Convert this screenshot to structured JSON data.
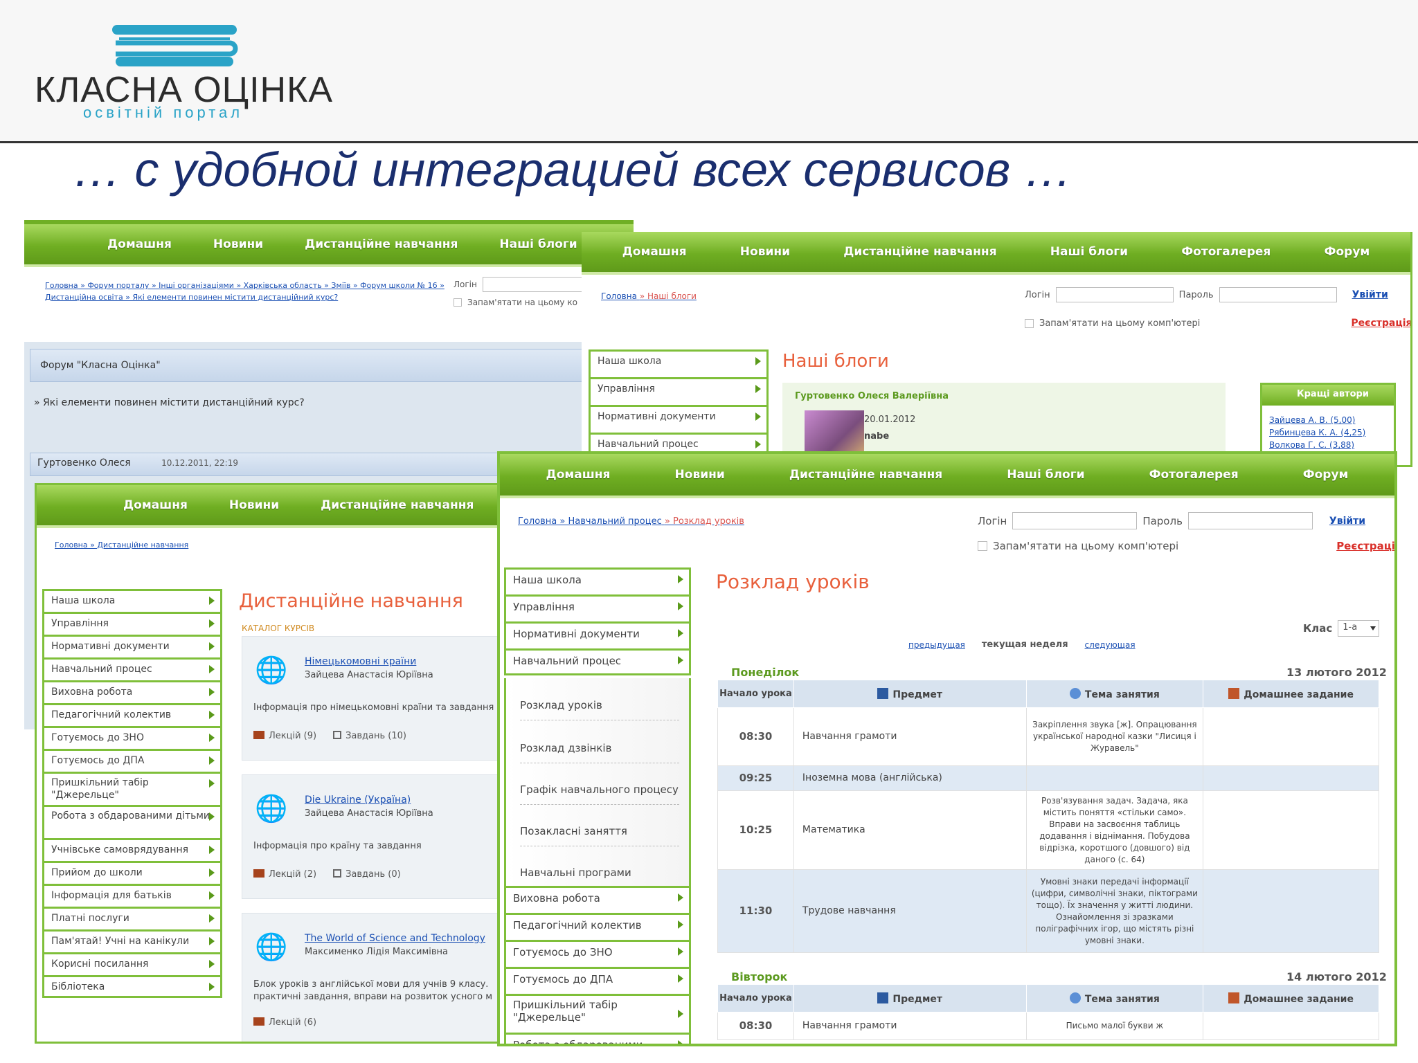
{
  "slide": {
    "logo_title": "КЛАСНА ОЦІНКА",
    "logo_subtitle": "освітній портал",
    "title": "… с удобной интеграцией всех сервисов …"
  },
  "forum": {
    "nav": [
      "Домашня",
      "Новини",
      "Дистанційне навчання",
      "Наші блоги"
    ],
    "breadcrumb": "Головна » Форум порталу » Інші організаціями » Харківська область » Зміїв » Форум школи № 16 » Дистанційна освіта » Які елементи повинен містити дистанційний курс?",
    "login_label": "Логін",
    "remember": "Запам'ятати на цьому ко",
    "forum_name": "Форум \"Класна Оцінка\"",
    "topic": "» Які елементи повинен містити дистанційний курс?",
    "author": "Гуртовенко Олеся",
    "post_date": "10.12.2011, 22:19"
  },
  "blogs": {
    "nav": [
      "Домашня",
      "Новини",
      "Дистанційне навчання",
      "Наші блоги",
      "Фотогалерея",
      "Форум"
    ],
    "breadcrumb_home": "Головна",
    "breadcrumb_current": "» Наші блоги",
    "login_label": "Логін",
    "password_label": "Пароль",
    "login_btn": "Увійти",
    "remember": "Запам'ятати на цьому комп'ютері",
    "register": "Реєстрація",
    "menu": [
      "Наша школа",
      "Управління",
      "Нормативні документи",
      "Навчальний процес"
    ],
    "heading": "Наші блоги",
    "blog_author": "Гуртовенко Олеся Валеріївна",
    "blog_date": "20.01.2012",
    "blog_text": "nabe",
    "best_title": "Кращі автори",
    "best_authors": [
      "Зайцева А. В. (5,00)",
      "Рябинцева К. А. (4,25)",
      "Волкова Г. С. (3,88)"
    ]
  },
  "distance": {
    "nav": [
      "Домашня",
      "Новини",
      "Дистанційне навчання"
    ],
    "breadcrumb": "Головна » Дистанційне навчання",
    "menu": [
      "Наша школа",
      "Управління",
      "Нормативні документи",
      "Навчальний процес",
      "Виховна робота",
      "Педагогічний колектив",
      "Готуємось до ЗНО",
      "Готуємось до ДПА",
      "Пришкільний табір \"Джерельце\"",
      "Робота з обдарованими дітьми",
      "Учнівське самоврядування",
      "Прийом до школи",
      "Інформація для батьків",
      "Платні послуги",
      "Пам'ятай! Учні на канікули",
      "Корисні посилання",
      "Бібліотека"
    ],
    "heading": "Дистанційне навчання",
    "catalog": "КАТАЛОГ КУРСІВ",
    "courses": [
      {
        "title": "Німецькомовні країни",
        "author": "Зайцева Анастасія Юріївна",
        "desc": "Інформація про німецькомовні країни та завдання",
        "lectures": "Лекцій (9)",
        "tasks": "Завдань (10)"
      },
      {
        "title": "Die Ukraine (Україна)",
        "author": "Зайцева Анастасія Юріївна",
        "desc": "Інформація про країну та завдання",
        "lectures": "Лекцій (2)",
        "tasks": "Завдань (0)"
      },
      {
        "title": "The World of Science and Technology",
        "author": "Максименко Лідія Максимівна",
        "desc": "Блок уроків з англійської мови для учнів 9 класу. практичні завдання, вправи на розвиток усного м",
        "lectures": "Лекцій (6)",
        "tasks": ""
      }
    ]
  },
  "schedule": {
    "nav": [
      "Домашня",
      "Новини",
      "Дистанційне навчання",
      "Наші блоги",
      "Фотогалерея",
      "Форум"
    ],
    "breadcrumb_parts": [
      "Головна",
      "Навчальний процес"
    ],
    "breadcrumb_current": "» Розклад уроків",
    "login_label": "Логін",
    "password_label": "Пароль",
    "login_btn": "Увійти",
    "remember": "Запам'ятати на цьому комп'ютері",
    "register": "Реєстрація",
    "menu_top": [
      "Наша школа",
      "Управління",
      "Нормативні документи",
      "Навчальний процес"
    ],
    "submenu": [
      "Розклад уроків",
      "Розклад дзвінків",
      "Графік навчального процесу",
      "Позакласні заняття",
      "Навчальні програми"
    ],
    "menu_bottom": [
      "Виховна робота",
      "Педагогічний колектив",
      "Готуємось до ЗНО",
      "Готуємось до ДПА",
      "Пришкільний табір \"Джерельце\"",
      "Робота з обдарованими"
    ],
    "heading": "Розклад уроків",
    "class_label": "Клас",
    "class_value": "1-а",
    "prev_week": "предыдущая",
    "current_week": "текущая неделя",
    "next_week": "следующая",
    "headers": [
      "Начало урока",
      "Предмет",
      "Тема занятия",
      "Домашнее задание"
    ],
    "days": [
      {
        "name": "Понеділок",
        "date": "13 лютого 2012",
        "lessons": [
          {
            "time": "08:30",
            "subject": "Навчання грамоти",
            "topic": "Закріплення звука [ж]. Опрацювання української народної казки \"Лисиця і Журавель\"",
            "hw": ""
          },
          {
            "time": "09:25",
            "subject": "Іноземна мова (англійська)",
            "topic": "",
            "hw": ""
          },
          {
            "time": "10:25",
            "subject": "Математика",
            "topic": "Розв'язування задач. Задача, яка містить поняття «стільки само». Вправи на засвоєння таблиць додавання і віднімання. Побудова відрізка, коротшого (довшого) від даного (с. 64)",
            "hw": ""
          },
          {
            "time": "11:30",
            "subject": "Трудове навчання",
            "topic": "Умовні знаки передачі інформації (цифри, символічні знаки, піктограми тощо). Їх значення у житті людини. Ознайомлення зі зразками поліграфічних ігор, що містять різні умовні знаки.",
            "hw": ""
          }
        ]
      },
      {
        "name": "Вівторок",
        "date": "14 лютого 2012",
        "lessons": [
          {
            "time": "08:30",
            "subject": "Навчання грамоти",
            "topic": "Письмо малої букви ж",
            "hw": ""
          }
        ]
      }
    ]
  }
}
